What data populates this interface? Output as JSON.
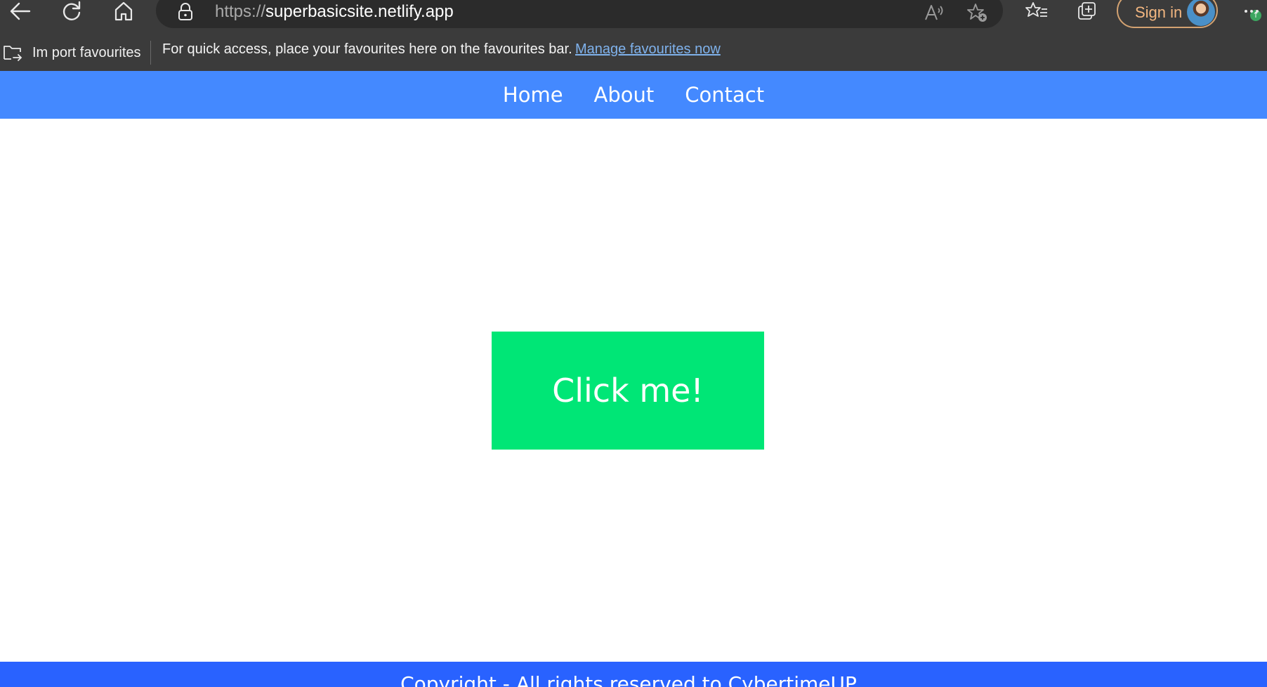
{
  "browser": {
    "url_protocol": "https://",
    "url_host": "superbasicsite.netlify.app",
    "sign_in_label": "Sign in",
    "badge_symbol": "↑",
    "favourites_bar": {
      "import_label": "Im port favourites",
      "message": "For quick access, place your favourites here on the favourites bar.",
      "manage_link": "Manage favourites now"
    }
  },
  "site": {
    "nav": {
      "items": [
        {
          "label": "Home"
        },
        {
          "label": "About"
        },
        {
          "label": "Contact"
        }
      ]
    },
    "main": {
      "button_label": "Click me!"
    },
    "footer": {
      "text": "Copyright - All rights reserved to CybertimeUP"
    }
  },
  "colors": {
    "nav_bg": "#4489ff",
    "button_bg": "#00e676",
    "footer_bg": "#2962ff",
    "chrome_bg": "#3b3b3b"
  }
}
